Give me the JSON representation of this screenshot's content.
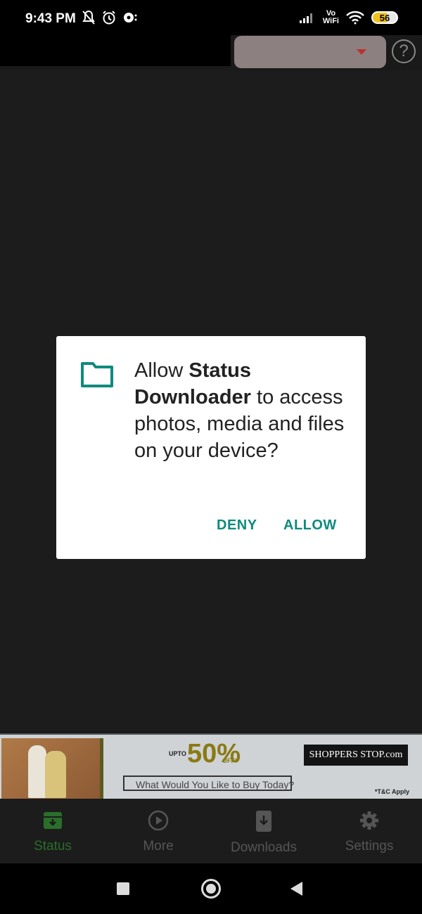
{
  "status_bar": {
    "time": "9:43 PM",
    "network": "Vo\nWiFi",
    "battery": "56"
  },
  "toolbar": {
    "help_symbol": "?"
  },
  "dialog": {
    "prefix": "Allow ",
    "app_name": "Status Downloader",
    "suffix": " to access photos, media and files on your device?",
    "deny_label": "DENY",
    "allow_label": "ALLOW",
    "icon": "folder-icon",
    "accent": "#0f8a7e"
  },
  "ad": {
    "upto": "UPTO",
    "discount": "50%",
    "off": "OFF*",
    "brand": "SHOPPERS STOP.com",
    "search_text": "What Would You Like to Buy Today?",
    "tc": "*T&C Apply"
  },
  "bottom_nav": {
    "items": [
      {
        "label": "Status",
        "icon": "archive-download-icon",
        "active": true
      },
      {
        "label": "More",
        "icon": "play-circle-icon"
      },
      {
        "label": "Downloads",
        "icon": "phone-download-icon"
      },
      {
        "label": "Settings",
        "icon": "gear-icon"
      }
    ],
    "active_color": "#2a6e2a"
  }
}
